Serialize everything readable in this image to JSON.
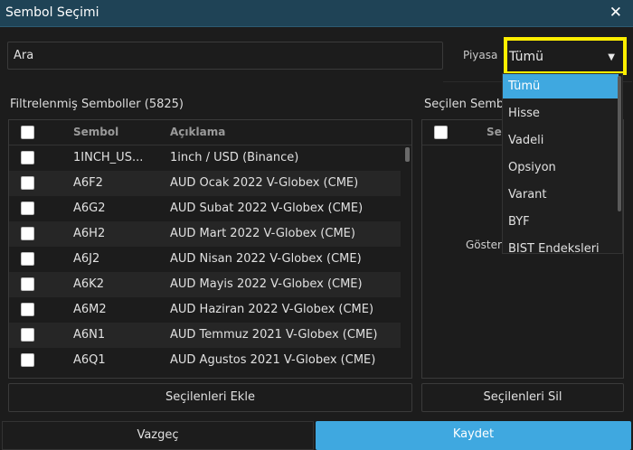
{
  "window": {
    "title": "Sembol Seçimi",
    "close_label": "✕"
  },
  "search": {
    "value": "Ara"
  },
  "market": {
    "label": "Piyasa",
    "selected": "Tümü",
    "options": [
      "Tümü",
      "Hisse",
      "Vadeli",
      "Opsiyon",
      "Varant",
      "BYF",
      "BIST Endeksleri"
    ]
  },
  "left_panel": {
    "title": "Filtrelenmiş Semboller (5825)",
    "col_symbol": "Sembol",
    "col_desc": "Açıklama",
    "rows": [
      {
        "symbol": "1INCH_US...",
        "desc": "1inch / USD (Binance)"
      },
      {
        "symbol": "A6F2",
        "desc": "AUD Ocak 2022 V-Globex (CME)"
      },
      {
        "symbol": "A6G2",
        "desc": "AUD Subat 2022 V-Globex (CME)"
      },
      {
        "symbol": "A6H2",
        "desc": "AUD Mart 2022 V-Globex (CME)"
      },
      {
        "symbol": "A6J2",
        "desc": "AUD Nisan 2022 V-Globex (CME)"
      },
      {
        "symbol": "A6K2",
        "desc": "AUD Mayis 2022 V-Globex (CME)"
      },
      {
        "symbol": "A6M2",
        "desc": "AUD Haziran 2022 V-Globex (CME)"
      },
      {
        "symbol": "A6N1",
        "desc": "AUD Temmuz 2021 V-Globex (CME)"
      },
      {
        "symbol": "A6Q1",
        "desc": "AUD Agustos 2021 V-Globex (CME)"
      }
    ],
    "add_button": "Seçilenleri Ekle"
  },
  "right_panel": {
    "title": "Seçilen Semb",
    "col_symbol": "Se",
    "empty_text": "Göster",
    "remove_button": "Seçilenleri Sil"
  },
  "footer": {
    "cancel": "Vazgeç",
    "save": "Kaydet"
  },
  "colors": {
    "accent": "#3fa8e0",
    "highlight": "#ffee00",
    "titlebar": "#1f4356"
  }
}
